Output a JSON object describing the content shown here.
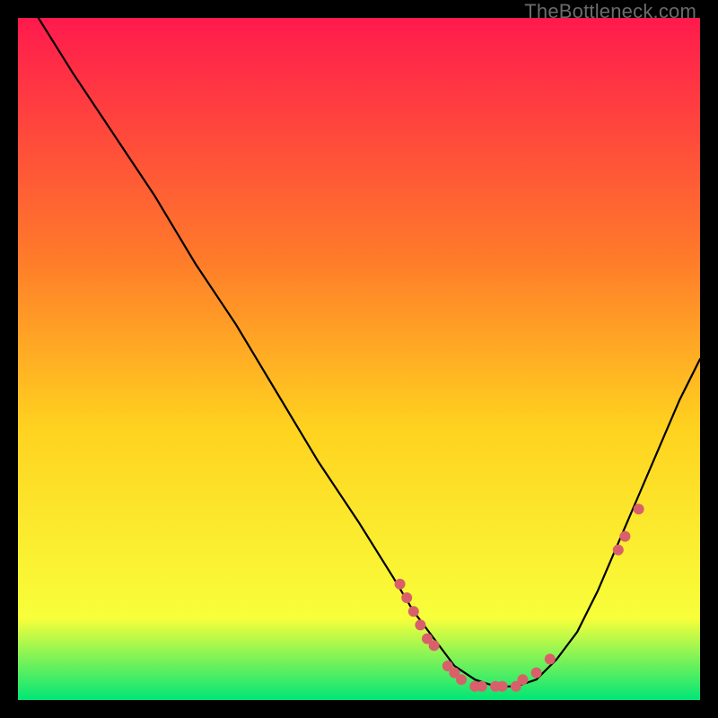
{
  "watermark": "TheBottleneck.com",
  "chart_data": {
    "type": "line",
    "title": "",
    "xlabel": "",
    "ylabel": "",
    "xlim": [
      0,
      100
    ],
    "ylim": [
      0,
      100
    ],
    "background_gradient": {
      "top": "#ff1a4d",
      "mid1": "#ff7a2a",
      "mid2": "#ffd21f",
      "mid3": "#f8ff3a",
      "bottom": "#00e676"
    },
    "series": [
      {
        "name": "bottleneck-curve",
        "stroke": "#000000",
        "x": [
          3,
          8,
          14,
          20,
          26,
          32,
          38,
          44,
          50,
          55,
          58,
          61,
          64,
          67,
          70,
          73,
          76,
          79,
          82,
          85,
          88,
          91,
          94,
          97,
          100
        ],
        "y": [
          100,
          92,
          83,
          74,
          64,
          55,
          45,
          35,
          26,
          18,
          13,
          9,
          5,
          3,
          2,
          2,
          3,
          6,
          10,
          16,
          23,
          30,
          37,
          44,
          50
        ]
      }
    ],
    "markers": {
      "name": "highlighted-points",
      "color": "#d9606a",
      "radius": 6,
      "points": [
        {
          "x": 56,
          "y": 17
        },
        {
          "x": 57,
          "y": 15
        },
        {
          "x": 58,
          "y": 13
        },
        {
          "x": 59,
          "y": 11
        },
        {
          "x": 60,
          "y": 9
        },
        {
          "x": 61,
          "y": 8
        },
        {
          "x": 63,
          "y": 5
        },
        {
          "x": 64,
          "y": 4
        },
        {
          "x": 65,
          "y": 3
        },
        {
          "x": 67,
          "y": 2
        },
        {
          "x": 68,
          "y": 2
        },
        {
          "x": 70,
          "y": 2
        },
        {
          "x": 71,
          "y": 2
        },
        {
          "x": 73,
          "y": 2
        },
        {
          "x": 74,
          "y": 3
        },
        {
          "x": 76,
          "y": 4
        },
        {
          "x": 78,
          "y": 6
        },
        {
          "x": 88,
          "y": 22
        },
        {
          "x": 89,
          "y": 24
        },
        {
          "x": 91,
          "y": 28
        }
      ]
    }
  }
}
